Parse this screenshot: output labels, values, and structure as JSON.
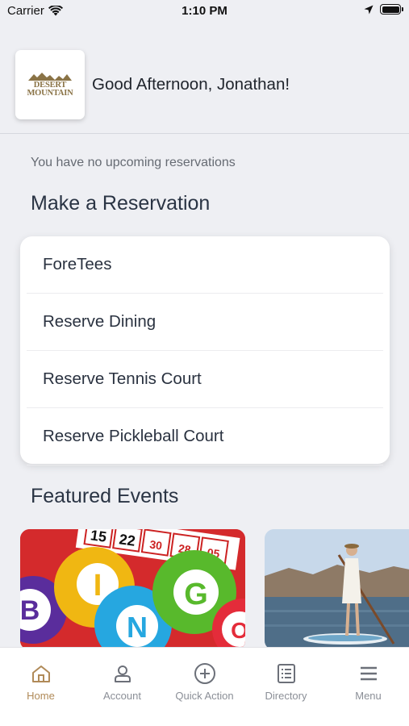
{
  "status_bar": {
    "carrier": "Carrier",
    "time": "1:10 PM"
  },
  "header": {
    "logo_line1": "DESERT",
    "logo_line2": "MOUNTAIN",
    "greeting": "Good Afternoon, Jonathan!"
  },
  "reservations": {
    "empty_message": "You have no upcoming reservations",
    "section_title": "Make a Reservation",
    "items": [
      {
        "label": "ForeTees"
      },
      {
        "label": "Reserve Dining"
      },
      {
        "label": "Reserve Tennis Court"
      },
      {
        "label": "Reserve Pickleball Court"
      }
    ]
  },
  "featured": {
    "section_title": "Featured Events",
    "bingo_letters": [
      "B",
      "I",
      "N",
      "G",
      "O"
    ],
    "card_numbers": [
      "15",
      "22",
      "30",
      "28",
      "05"
    ]
  },
  "tab_bar": {
    "active": "Home",
    "tabs": [
      {
        "label": "Home",
        "icon": "home-icon"
      },
      {
        "label": "Account",
        "icon": "account-icon"
      },
      {
        "label": "Quick Action",
        "icon": "plus-circle-icon"
      },
      {
        "label": "Directory",
        "icon": "directory-icon"
      },
      {
        "label": "Menu",
        "icon": "hamburger-menu-icon"
      }
    ]
  },
  "colors": {
    "background": "#eeeff3",
    "accent": "#b08a58",
    "logo_gold": "#8a7346",
    "text_dark": "#2a3240",
    "tab_inactive": "#8b8f97"
  }
}
